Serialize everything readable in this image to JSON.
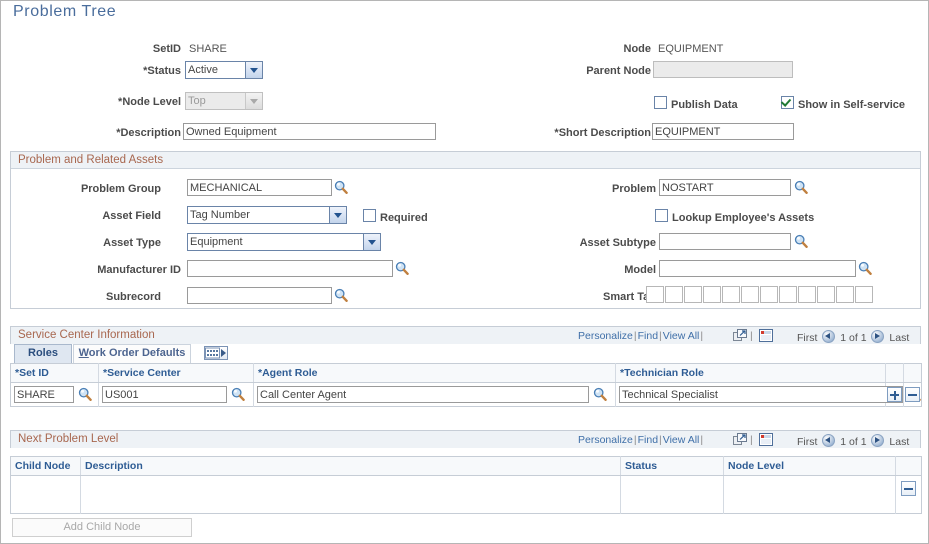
{
  "page": {
    "title": "Problem Tree"
  },
  "header": {
    "setid_label": "SetID",
    "setid_value": "SHARE",
    "status_label": "Status",
    "status_value": "Active",
    "node_level_label": "Node Level",
    "node_level_value": "Top",
    "description_label": "Description",
    "description_value": "Owned Equipment",
    "node_label": "Node",
    "node_value": "EQUIPMENT",
    "parent_node_label": "Parent Node",
    "parent_node_value": "",
    "publish_data_label": "Publish Data",
    "publish_data_checked": false,
    "show_self_service_label": "Show in Self-service",
    "show_self_service_checked": true,
    "short_description_label": "Short Description",
    "short_description_value": "EQUIPMENT"
  },
  "problem_assets": {
    "caption": "Problem and Related Assets",
    "problem_group_label": "Problem Group",
    "problem_group_value": "MECHANICAL",
    "asset_field_label": "Asset Field",
    "asset_field_value": "Tag Number",
    "required_label": "Required",
    "required_checked": false,
    "asset_type_label": "Asset Type",
    "asset_type_value": "Equipment",
    "manufacturer_id_label": "Manufacturer ID",
    "manufacturer_id_value": "",
    "subrecord_label": "Subrecord",
    "subrecord_value": "",
    "problem_label": "Problem",
    "problem_value": "NOSTART",
    "lookup_employee_assets_label": "Lookup Employee's Assets",
    "lookup_employee_assets_checked": false,
    "asset_subtype_label": "Asset Subtype",
    "asset_subtype_value": "",
    "model_label": "Model",
    "model_value": "",
    "smart_tag_label": "Smart Tag",
    "smart_tag_boxes": 12
  },
  "service_center": {
    "caption": "Service Center Information",
    "toolbar": {
      "personalize": "Personalize",
      "find": "Find",
      "view_all": "View All",
      "first": "First",
      "count": "1 of 1",
      "last": "Last"
    },
    "tabs": [
      {
        "label": "Roles",
        "active": true
      },
      {
        "label": "Work Order Defaults",
        "active": false
      }
    ],
    "columns": [
      "Set ID",
      "Service Center",
      "Agent Role",
      "Technician Role",
      "",
      ""
    ],
    "rows": [
      {
        "set_id": "SHARE",
        "service_center": "US001",
        "agent_role": "Call Center Agent",
        "technician_role": "Technical Specialist"
      }
    ]
  },
  "next_problem_level": {
    "caption": "Next Problem Level",
    "toolbar": {
      "personalize": "Personalize",
      "find": "Find",
      "view_all": "View All",
      "first": "First",
      "count": "1 of 1",
      "last": "Last"
    },
    "columns": [
      "Child Node",
      "Description",
      "Status",
      "Node Level",
      ""
    ],
    "rows": [
      {
        "child_node": "",
        "description": "",
        "status": "",
        "node_level": ""
      }
    ],
    "add_child_node_label": "Add Child Node"
  },
  "colors": {
    "title": "#4a6d9c",
    "group_caption": "#a8674f",
    "column_header": "#2e5c94",
    "link": "#3f6fa8",
    "check": "#1f7a34"
  }
}
